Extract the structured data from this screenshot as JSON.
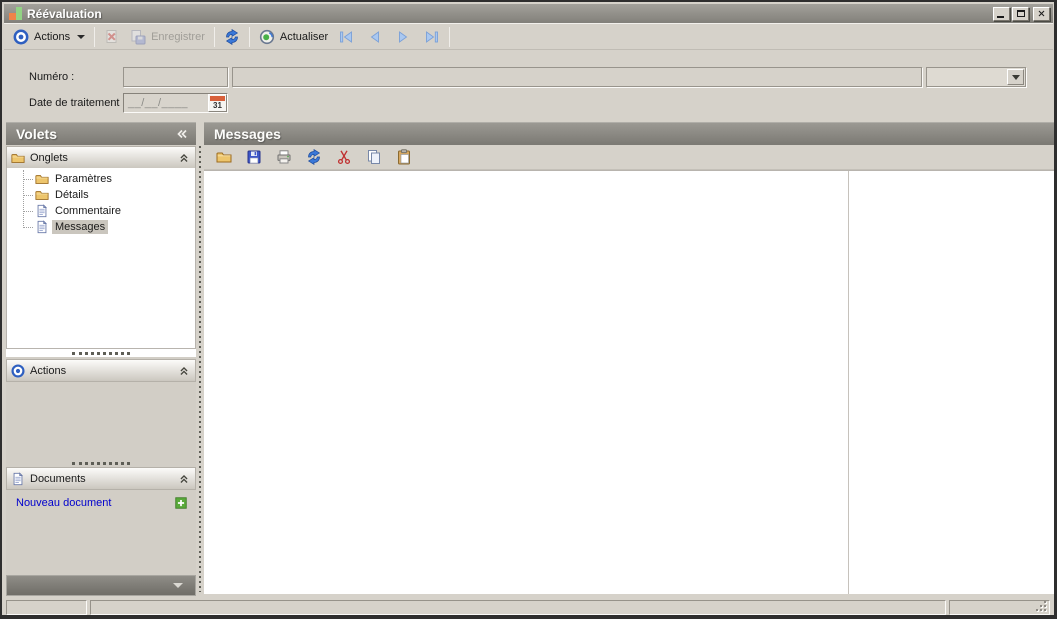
{
  "window": {
    "title": "Réévaluation"
  },
  "toolbar": {
    "actions_label": "Actions",
    "enregistrer_label": "Enregistrer",
    "actualiser_label": "Actualiser"
  },
  "form": {
    "numero_label": "Numéro :",
    "numero_value": "",
    "numero_description_value": "",
    "combo_value": "",
    "date_label": "Date de traitement :",
    "date_mask": "__/__/____",
    "calendar_day": "31"
  },
  "sidebar": {
    "title": "Volets",
    "onglets_label": "Onglets",
    "actions_label": "Actions",
    "documents_label": "Documents",
    "tree": [
      {
        "label": "Paramètres",
        "icon": "folder-icon",
        "selected": false
      },
      {
        "label": "Détails",
        "icon": "folder-icon",
        "selected": false
      },
      {
        "label": "Commentaire",
        "icon": "document-icon",
        "selected": false
      },
      {
        "label": "Messages",
        "icon": "document-icon",
        "selected": true
      }
    ],
    "new_document_label": "Nouveau document"
  },
  "main": {
    "title": "Messages",
    "toolbar_icons": [
      "open-folder-icon",
      "save-icon",
      "print-icon",
      "refresh-icon",
      "cut-icon",
      "copy-icon",
      "paste-icon"
    ]
  },
  "colors": {
    "window_bg": "#d6d2ca",
    "panel_header_bg": "#8a8882",
    "accent_blue": "#2e5fc0",
    "link_blue": "#0000cd",
    "selection_bg": "#cac6be",
    "disabled_text": "#a09e98"
  }
}
